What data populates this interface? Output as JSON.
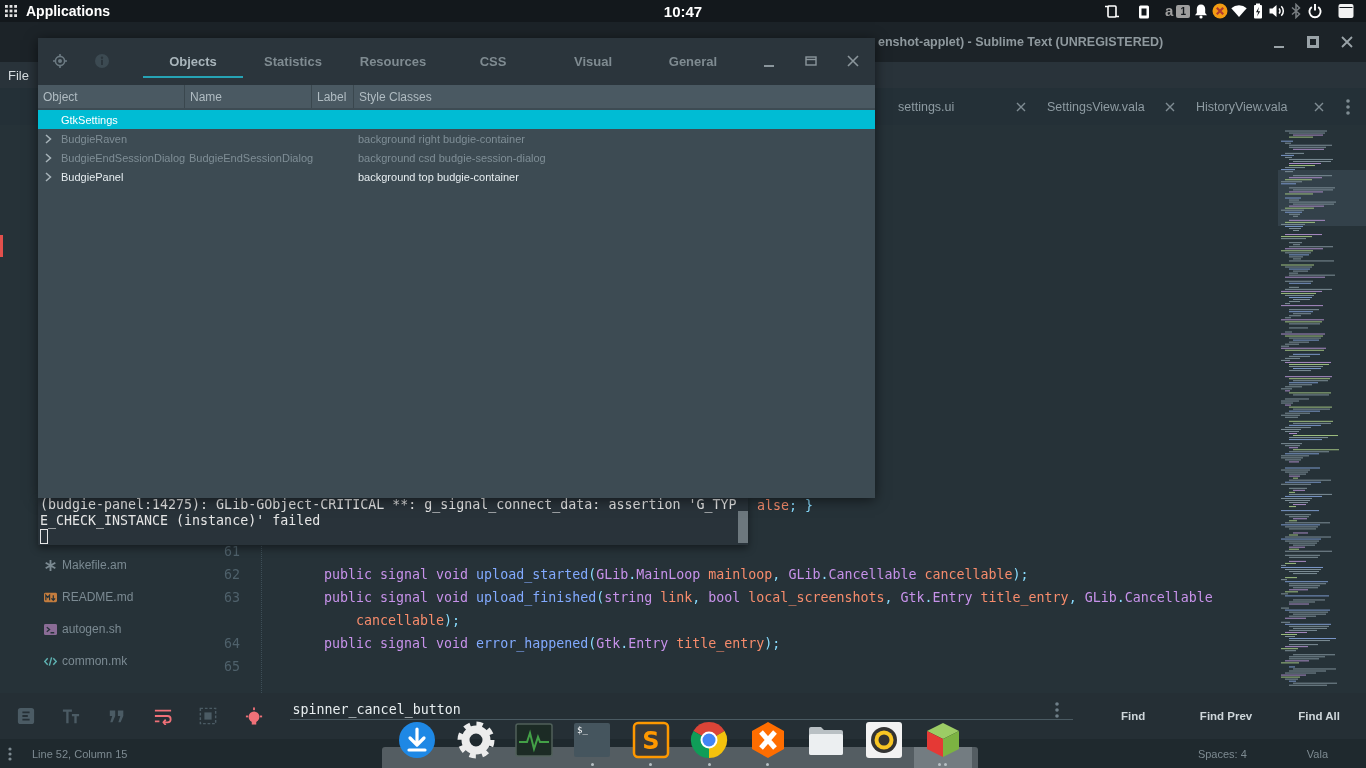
{
  "top_panel": {
    "menu_label": "Applications",
    "clock": "10:47",
    "tray": [
      {
        "kind": "rotation"
      },
      {
        "kind": "clipboard"
      },
      {
        "kind": "letter",
        "text": "a"
      },
      {
        "kind": "counter",
        "text": "1"
      },
      {
        "kind": "bell"
      },
      {
        "kind": "blocked"
      },
      {
        "kind": "wifi"
      },
      {
        "kind": "battery"
      },
      {
        "kind": "volume"
      },
      {
        "kind": "bluetooth"
      },
      {
        "kind": "power"
      },
      {
        "kind": "window"
      }
    ]
  },
  "editor_window": {
    "title": "enshot-applet) - Sublime Text (UNREGISTERED)",
    "menu": [
      "File"
    ],
    "tabs": [
      {
        "label": "settings.ui",
        "selected": false
      },
      {
        "label": "SettingsView.vala",
        "selected": false
      },
      {
        "label": "HistoryView.vala",
        "selected": false
      }
    ],
    "files": [
      {
        "name": "Makefile.am",
        "kind": "asterisk"
      },
      {
        "name": "README.md",
        "kind": "markdown"
      },
      {
        "name": "autogen.sh",
        "kind": "shell"
      },
      {
        "name": "common.mk",
        "kind": "code"
      }
    ],
    "code_lines": [
      {
        "kind": "partial",
        "tokens": [
          {
            "kind": "literal",
            "text": "alse"
          },
          {
            "kind": "punct",
            "text": "; }"
          }
        ]
      },
      {
        "kind": "line",
        "number": "61"
      },
      {
        "kind": "line",
        "number": "62",
        "tokens": [
          {
            "kind": "keyword",
            "text": "public signal void "
          },
          {
            "kind": "function",
            "text": "upload_started"
          },
          {
            "kind": "punct",
            "text": "("
          },
          {
            "kind": "type",
            "text": "GLib"
          },
          {
            "kind": "punct",
            "text": "."
          },
          {
            "kind": "type",
            "text": "MainLoop"
          },
          {
            "kind": "param",
            "text": " mainloop"
          },
          {
            "kind": "punct",
            "text": ", "
          },
          {
            "kind": "type",
            "text": "GLib"
          },
          {
            "kind": "punct",
            "text": "."
          },
          {
            "kind": "type",
            "text": "Cancellable"
          },
          {
            "kind": "param",
            "text": " cancellable"
          },
          {
            "kind": "punct",
            "text": ");"
          }
        ]
      },
      {
        "kind": "line",
        "number": "63",
        "tokens": [
          {
            "kind": "keyword",
            "text": "public signal void "
          },
          {
            "kind": "function",
            "text": "upload_finished"
          },
          {
            "kind": "punct",
            "text": "("
          },
          {
            "kind": "type",
            "text": "string"
          },
          {
            "kind": "param",
            "text": " link"
          },
          {
            "kind": "punct",
            "text": ", "
          },
          {
            "kind": "type",
            "text": "bool"
          },
          {
            "kind": "param",
            "text": " local_screenshots"
          },
          {
            "kind": "punct",
            "text": ", "
          },
          {
            "kind": "type",
            "text": "Gtk"
          },
          {
            "kind": "punct",
            "text": "."
          },
          {
            "kind": "type",
            "text": "Entry"
          },
          {
            "kind": "param",
            "text": " title_entry"
          },
          {
            "kind": "punct",
            "text": ", "
          },
          {
            "kind": "type",
            "text": "GLib"
          },
          {
            "kind": "punct",
            "text": "."
          },
          {
            "kind": "type",
            "text": "Cancellable"
          }
        ]
      },
      {
        "kind": "wrap",
        "tokens": [
          {
            "kind": "param",
            "text": "cancellable"
          },
          {
            "kind": "punct",
            "text": ");"
          }
        ]
      },
      {
        "kind": "line",
        "number": "64",
        "tokens": [
          {
            "kind": "keyword",
            "text": "public signal void "
          },
          {
            "kind": "function",
            "text": "error_happened"
          },
          {
            "kind": "punct",
            "text": "("
          },
          {
            "kind": "type",
            "text": "Gtk"
          },
          {
            "kind": "punct",
            "text": "."
          },
          {
            "kind": "type",
            "text": "Entry"
          },
          {
            "kind": "param",
            "text": " title_entry"
          },
          {
            "kind": "punct",
            "text": ");"
          }
        ]
      },
      {
        "kind": "line",
        "number": "65"
      }
    ],
    "find_panel": {
      "options": [
        {
          "kind": "regex",
          "on": false
        },
        {
          "kind": "case",
          "on": false
        },
        {
          "kind": "word",
          "on": false
        },
        {
          "kind": "wrap",
          "on": true
        },
        {
          "kind": "selection",
          "on": false
        },
        {
          "kind": "highlight",
          "on": true
        }
      ],
      "query": "spinner_cancel_button",
      "buttons": [
        "Find",
        "Find Prev",
        "Find All"
      ]
    },
    "status_bar": {
      "position": "Line 52, Column 15",
      "indentation": "Spaces: 4",
      "syntax": "Vala"
    }
  },
  "inspector": {
    "tabs": [
      {
        "label": "Objects",
        "selected": true
      },
      {
        "label": "Statistics",
        "selected": false
      },
      {
        "label": "Resources",
        "selected": false
      },
      {
        "label": "CSS",
        "selected": false
      },
      {
        "label": "Visual",
        "selected": false
      },
      {
        "label": "General",
        "selected": false
      }
    ],
    "columns": [
      "Object",
      "Name",
      "Label",
      "Style Classes"
    ],
    "rows": [
      {
        "object": "GtkSettings",
        "expandable": false,
        "visible": true,
        "selected": true
      },
      {
        "object": "BudgieRaven",
        "style_classes": "background right budgie-container",
        "expandable": true,
        "visible": false,
        "selected": false
      },
      {
        "object": "BudgieEndSessionDialog",
        "name": "BudgieEndSessionDialog",
        "style_classes": "background csd budgie-session-dialog",
        "expandable": true,
        "visible": false,
        "selected": false
      },
      {
        "object": "BudgiePanel",
        "style_classes": "background top budgie-container",
        "expandable": true,
        "visible": true,
        "selected": false
      }
    ]
  },
  "terminal": {
    "lines": [
      "(budgie-panel:14275): GLib-GObject-CRITICAL **: g_signal_connect_data: assertion 'G_TYP",
      "E_CHECK_INSTANCE (instance)' failed"
    ],
    "focused": false
  },
  "dock": [
    {
      "kind": "download",
      "running": false,
      "multiple_windows": false,
      "selected": false
    },
    {
      "kind": "settings",
      "running": false,
      "multiple_windows": false,
      "selected": false
    },
    {
      "kind": "monitor",
      "running": false,
      "multiple_windows": false,
      "selected": false
    },
    {
      "kind": "terminal",
      "glyph": "$_",
      "running": true,
      "multiple_windows": false,
      "selected": false
    },
    {
      "kind": "editor",
      "glyph": "S",
      "running": true,
      "multiple_windows": false,
      "selected": false
    },
    {
      "kind": "browser",
      "running": true,
      "multiple_windows": false,
      "selected": false
    },
    {
      "kind": "hexagon",
      "running": true,
      "multiple_windows": false,
      "selected": false
    },
    {
      "kind": "files",
      "running": false,
      "multiple_windows": false,
      "selected": false
    },
    {
      "kind": "music",
      "running": false,
      "multiple_windows": false,
      "selected": false
    },
    {
      "kind": "cube",
      "running": true,
      "multiple_windows": true,
      "selected": true
    }
  ]
}
